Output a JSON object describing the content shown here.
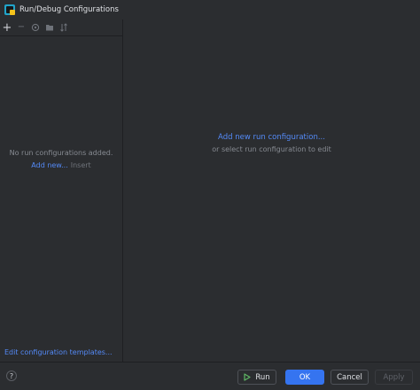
{
  "window": {
    "title": "Run/Debug Configurations",
    "icon": "run-debug-app-icon"
  },
  "toolbar": {
    "buttons": [
      {
        "name": "add",
        "icon": "plus-icon",
        "glyph": "+"
      },
      {
        "name": "remove",
        "icon": "minus-icon",
        "glyph": "−"
      },
      {
        "name": "copy",
        "icon": "copy-icon"
      },
      {
        "name": "folder",
        "icon": "folder-icon"
      },
      {
        "name": "sort",
        "icon": "sort-icon"
      }
    ]
  },
  "left_panel": {
    "empty_message": "No run configurations added.",
    "add_new_link": "Add new...",
    "add_new_shortcut": "Insert",
    "edit_templates_link": "Edit configuration templates..."
  },
  "right_panel": {
    "add_config_link": "Add new run configuration...",
    "select_hint": "or select run configuration to edit"
  },
  "footer": {
    "help_label": "?",
    "run_label": "Run",
    "ok_label": "OK",
    "cancel_label": "Cancel",
    "apply_label": "Apply"
  },
  "colors": {
    "background": "#2b2d30",
    "link": "#548af7",
    "primary_button": "#3574f0",
    "run_icon": "#5fb865"
  }
}
